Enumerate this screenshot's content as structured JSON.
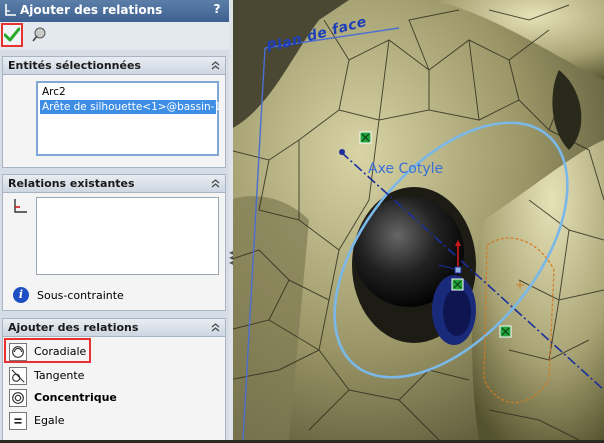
{
  "panel": {
    "title": "Ajouter des relations",
    "help_label": "?",
    "toolbar": {
      "ok_icon": "checkmark-icon",
      "pin_icon": "pushpin-icon"
    },
    "groups": {
      "selected": {
        "title": "Entités sélectionnées",
        "items": [
          "Arc2",
          "Arête de silhouette<1>@bassin-1"
        ]
      },
      "existing": {
        "title": "Relations existantes",
        "status": "Sous-contrainte",
        "items": []
      },
      "add": {
        "title": "Ajouter des relations",
        "relations": [
          {
            "label": "Coradiale",
            "icon": "coradial-icon",
            "highlighted": true
          },
          {
            "label": "Tangente",
            "icon": "tangent-icon"
          },
          {
            "label": "Concentrique",
            "icon": "concentric-icon",
            "bold": true
          },
          {
            "label": "Egale",
            "icon": "equal-icon"
          }
        ]
      }
    }
  },
  "viewport": {
    "plane_label": "Plan de face",
    "axis_label": "Axe Cotyle"
  },
  "colors": {
    "accent": "#3f8ee6",
    "highlight_box": "#e8322f",
    "bone": "#b8b48a",
    "mesh_line": "#2b2a1a",
    "sphere": "#1a1a1a",
    "circle": "#7ab8e8"
  }
}
